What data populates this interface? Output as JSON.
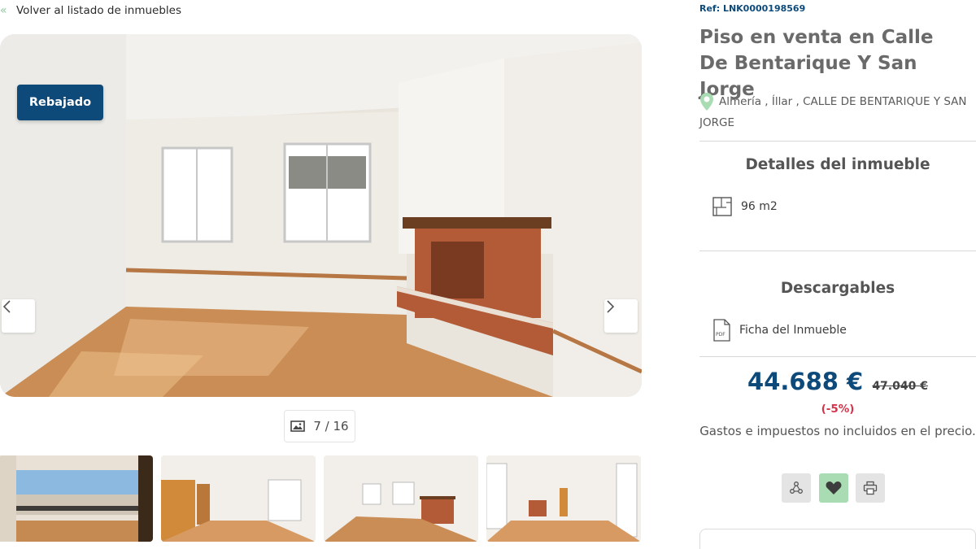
{
  "back_link": {
    "label": "Volver al listado de inmuebles",
    "icon": "double-chevron-left-icon"
  },
  "gallery": {
    "badge": "Rebajado",
    "counter": "7 / 16",
    "counter_icon": "image-icon",
    "prev_icon": "chevron-left-icon",
    "next_icon": "chevron-right-icon",
    "thumbnails": [
      "terrace",
      "hallway",
      "living-room-fireplace",
      "living-room-window"
    ]
  },
  "property": {
    "ref": "Ref: LNK0000198569",
    "title": "Piso en venta en Calle De Bentarique Y San Jorge",
    "location": "Almería , Íllar , CALLE DE BENTARIQUE Y SAN JORGE",
    "location_icon": "map-pin-icon"
  },
  "details": {
    "heading": "Detalles del inmueble",
    "area": "96 m2",
    "area_icon": "floorplan-icon"
  },
  "downloads": {
    "heading": "Descargables",
    "file_label": "Ficha del Inmueble",
    "file_icon": "pdf-icon"
  },
  "pricing": {
    "current": "44.688 €",
    "old": "47.040 €",
    "discount": "(-5%)",
    "note": "Gastos e impuestos no incluidos en el precio."
  },
  "actions": {
    "share_icon": "share-icon",
    "favorite_icon": "heart-icon",
    "print_icon": "print-icon"
  },
  "colors": {
    "brand": "#0d4a7a",
    "accent_green": "#a9dcb3",
    "discount_red": "#d6334a"
  }
}
